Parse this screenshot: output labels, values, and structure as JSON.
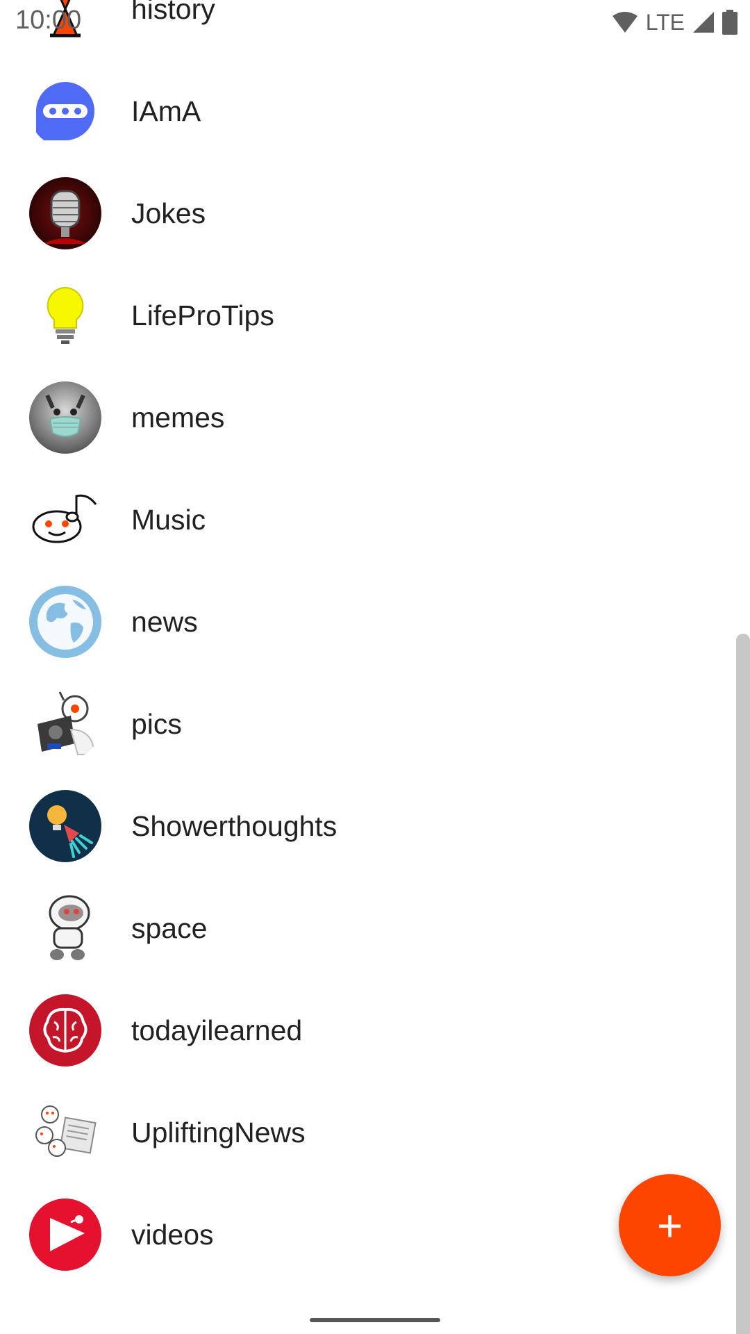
{
  "status_bar": {
    "time": "10:00",
    "network": "LTE"
  },
  "subreddits": [
    {
      "name": "history",
      "icon": "hourglass-icon"
    },
    {
      "name": "IAmA",
      "icon": "ama-icon"
    },
    {
      "name": "Jokes",
      "icon": "microphone-icon"
    },
    {
      "name": "LifeProTips",
      "icon": "lightbulb-icon"
    },
    {
      "name": "memes",
      "icon": "cat-mask-icon"
    },
    {
      "name": "Music",
      "icon": "music-note-icon"
    },
    {
      "name": "news",
      "icon": "globe-icon"
    },
    {
      "name": "pics",
      "icon": "camera-snoo-icon"
    },
    {
      "name": "Showerthoughts",
      "icon": "shower-idea-icon"
    },
    {
      "name": "space",
      "icon": "astronaut-icon"
    },
    {
      "name": "todayilearned",
      "icon": "brain-icon"
    },
    {
      "name": "UpliftingNews",
      "icon": "snoo-newspaper-icon"
    },
    {
      "name": "videos",
      "icon": "play-icon"
    }
  ],
  "fab": {
    "label": "+",
    "icon": "add-icon"
  },
  "colors": {
    "accent": "#fe4500"
  }
}
